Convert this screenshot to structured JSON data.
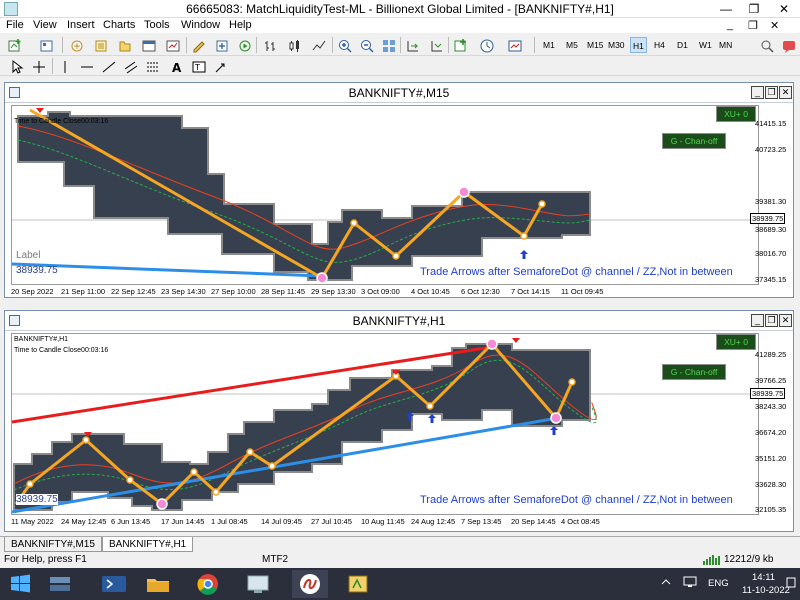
{
  "window": {
    "title": "66665083: MatchLiquidityTest-ML - Billionext Global Limited - [BANKNIFTY#,H1]",
    "minimize": "—",
    "restore": "❐",
    "close": "✕"
  },
  "menu": {
    "items": [
      "File",
      "View",
      "Insert",
      "Charts",
      "Tools",
      "Window",
      "Help"
    ],
    "mdi_minimize": "_",
    "mdi_restore": "❐",
    "mdi_close": "✕"
  },
  "timeframes": [
    "M1",
    "M5",
    "M15",
    "M30",
    "H1",
    "H4",
    "D1",
    "W1",
    "MN"
  ],
  "active_timeframe": "H1",
  "charts": [
    {
      "window_title": "BANKNIFTY#,M15",
      "ohlc_label": "",
      "timer_label": "Time to Candle Close00:03:16",
      "badge": "XU+ 0",
      "chan_status": "G - Chan-off",
      "label_text": "Label",
      "price_box": "38939.75",
      "current_price": "38939.75",
      "note": "Trade Arrows after SemaforeDot @ channel / ZZ,Not in between",
      "price_levels": [
        "41415.15",
        "40723.25",
        "39381.30",
        "38939.75",
        "38689.30",
        "38016.70",
        "37345.15"
      ],
      "time_labels": [
        "20 Sep 2022",
        "21 Sep 11:00",
        "22 Sep 12:45",
        "23 Sep 14:30",
        "27 Sep 10:00",
        "28 Sep 11:45",
        "29 Sep 13:30",
        "3 Oct 09:00",
        "4 Oct 10:45",
        "6 Oct 12:30",
        "7 Oct 14:15",
        "11 Oct 09:45"
      ]
    },
    {
      "window_title": "BANKNIFTY#,H1",
      "ohlc_label": "BANKNIFTY#,H1",
      "timer_label": "Time to Candle Close00:03:16",
      "badge": "XU+ 0",
      "chan_status": "G - Chan-off",
      "price_box": "38939.75",
      "current_price": "38939.75",
      "note": "Trade Arrows after SemaforeDot @ channel / ZZ,Not in between",
      "price_levels": [
        "41289.25",
        "39766.25",
        "38939.75",
        "38243.30",
        "36674.20",
        "35151.20",
        "33628.30",
        "32105.35"
      ],
      "time_labels": [
        "11 May 2022",
        "24 May 12:45",
        "6 Jun 13:45",
        "17 Jun 14:45",
        "1 Jul 08:45",
        "14 Jul 09:45",
        "27 Jul 10:45",
        "10 Aug 11:45",
        "24 Aug 12:45",
        "7 Sep 13:45",
        "20 Sep 14:45",
        "4 Oct 08:45"
      ]
    }
  ],
  "tabs": [
    "BANKNIFTY#,M15",
    "BANKNIFTY#,H1"
  ],
  "active_tab": "BANKNIFTY#,H1",
  "status": {
    "help": "For Help, press F1",
    "profile": "MTF2",
    "traffic": "12212/9 kb"
  },
  "taskbar": {
    "language": "ENG",
    "time": "14:11",
    "date": "11-10-2022"
  },
  "colors": {
    "channel_fill": "#37404e",
    "zigzag": "#f5a623",
    "upper_trend": "#e81c1c",
    "lower_trend": "#2d8ee8",
    "note_text": "#1f3fcf",
    "chan_box_bg": "#1b4d1b",
    "chan_box_text": "#4cd94c"
  }
}
